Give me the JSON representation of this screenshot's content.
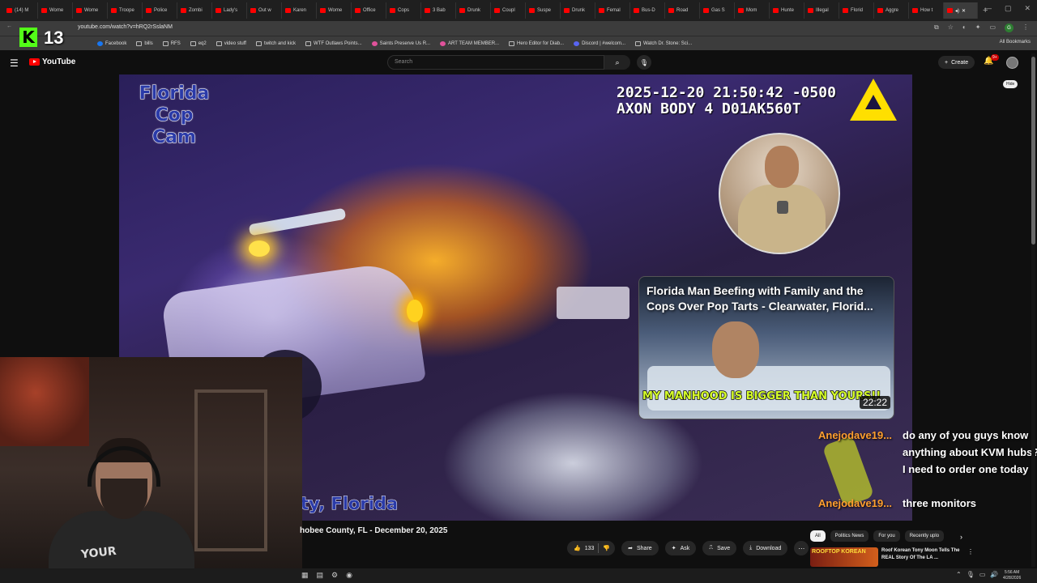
{
  "browser": {
    "tabs": [
      "(14) M",
      "Wome",
      "Wome",
      "Troope",
      "Police",
      "Zombi",
      "Lady's",
      "Out w",
      "Karen",
      "Wome",
      "Office",
      "Cops",
      "3 Bab",
      "Drunk",
      "Coupl",
      "Suspe",
      "Drunk",
      "Femal",
      "Bus-D",
      "Road",
      "Gas S",
      "Mom",
      "Hunte",
      "Illegal",
      "Florid",
      "Aggre",
      "How t"
    ],
    "active_tab": "",
    "url": "youtube.com/watch?v=hRQ2rSslaNM",
    "bookmarks": [
      "Facebook",
      "bills",
      "RFS",
      "eq2",
      "video stuff",
      "twitch and kick",
      "WTF Outlaws Points...",
      "Saints Preserve Us R...",
      "ART TEAM MEMBER...",
      "Hero Editor for Diab...",
      "Discord | #welcom...",
      "Watch Dr. Stone: Sci..."
    ],
    "all_bookmarks": "All Bookmarks",
    "profile_letter": "G"
  },
  "overlay": {
    "kick_count": "13"
  },
  "youtube": {
    "logo_text": "YouTube",
    "search_placeholder": "Search",
    "create_label": "Create",
    "notifications_badge": "9+",
    "hide_chip": "Hide"
  },
  "video": {
    "overlay_title": "Florida Cop Cam",
    "timestamp_line1": "2025-12-20 21:50:42 -0500",
    "timestamp_line2": "AXON BODY 4 D01AK560T",
    "location_text": "ty, Florida",
    "rec_title": "Florida Man Beefing with Family and the Cops Over Pop Tarts - Clearwater, Florid...",
    "rec_caption": "MY MANHOOD IS BIGGER THAN YOURS!!",
    "rec_duration": "22:22",
    "title_below": "hobee County, FL - December 20, 2025"
  },
  "chat": [
    {
      "user": "Anejodave19...",
      "message": "do any of you guys know anything about KVM hubs? I need to order one today"
    },
    {
      "user": "Anejodave19...",
      "message": "three monitors"
    }
  ],
  "webcam": {
    "shirt_text": "YOUR"
  },
  "actions": {
    "likes": "133",
    "share": "Share",
    "ask": "Ask",
    "save": "Save",
    "download": "Download"
  },
  "sidebar": {
    "chips": [
      "All",
      "Politics News",
      "For you",
      "Recently uplo"
    ],
    "item": {
      "thumb_text": "ROOFTOP KOREAN",
      "title": "Roof Korean Tony Moon Tells The REAL Story Of The LA ..."
    }
  },
  "taskbar": {
    "time": "5:56 AM",
    "date": "4/28/2026"
  },
  "colors": {
    "youtube_red": "#ff0000",
    "kick_green": "#53fc18",
    "chat_user": "#ff9f2e",
    "caption_yellow": "#d7ff2a",
    "axon_yellow": "#ffdf00"
  }
}
